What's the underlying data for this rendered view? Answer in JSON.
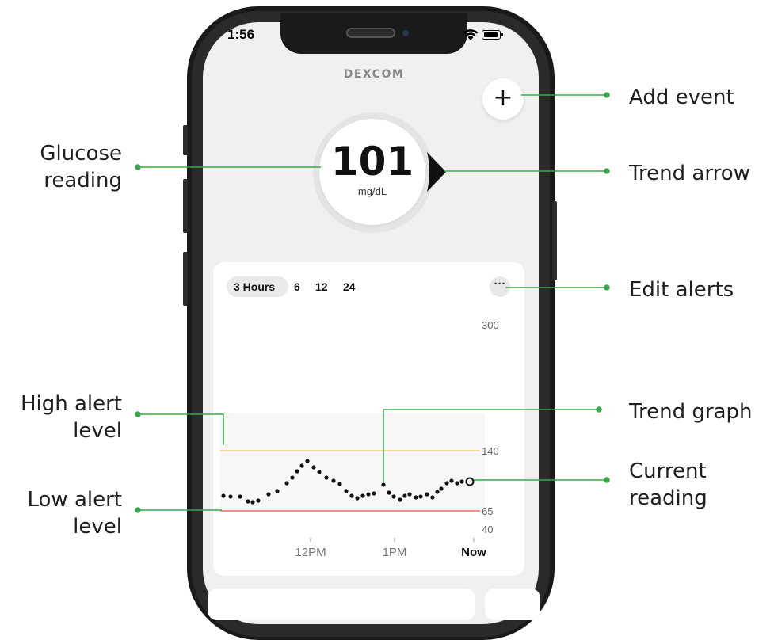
{
  "status_bar": {
    "time": "1:56"
  },
  "app": {
    "brand": "DEXCOM"
  },
  "add_event": {
    "label": "+"
  },
  "glucose": {
    "value": "101",
    "unit": "mg/dL"
  },
  "graph": {
    "tabs": [
      {
        "label": "3 Hours",
        "selected": true
      },
      {
        "label": "6",
        "selected": false
      },
      {
        "label": "12",
        "selected": false
      },
      {
        "label": "24",
        "selected": false
      }
    ],
    "more_label": "···",
    "y_labels": [
      "300",
      "140",
      "65",
      "40"
    ],
    "x_labels": [
      "12PM",
      "1PM",
      "Now"
    ],
    "high_alert": 140,
    "low_alert": 65,
    "colors": {
      "high_line": "#f2d27a",
      "low_line": "#e96b6b",
      "callout_green": "#3aa84a"
    }
  },
  "callouts": {
    "glucose_reading": "Glucose\nreading",
    "add_event": "Add event",
    "trend_arrow": "Trend arrow",
    "edit_alerts": "Edit alerts",
    "high_alert_level": "High alert\nlevel",
    "trend_graph": "Trend graph",
    "current_reading": "Current\nreading",
    "low_alert_level": "Low alert\nlevel"
  }
}
